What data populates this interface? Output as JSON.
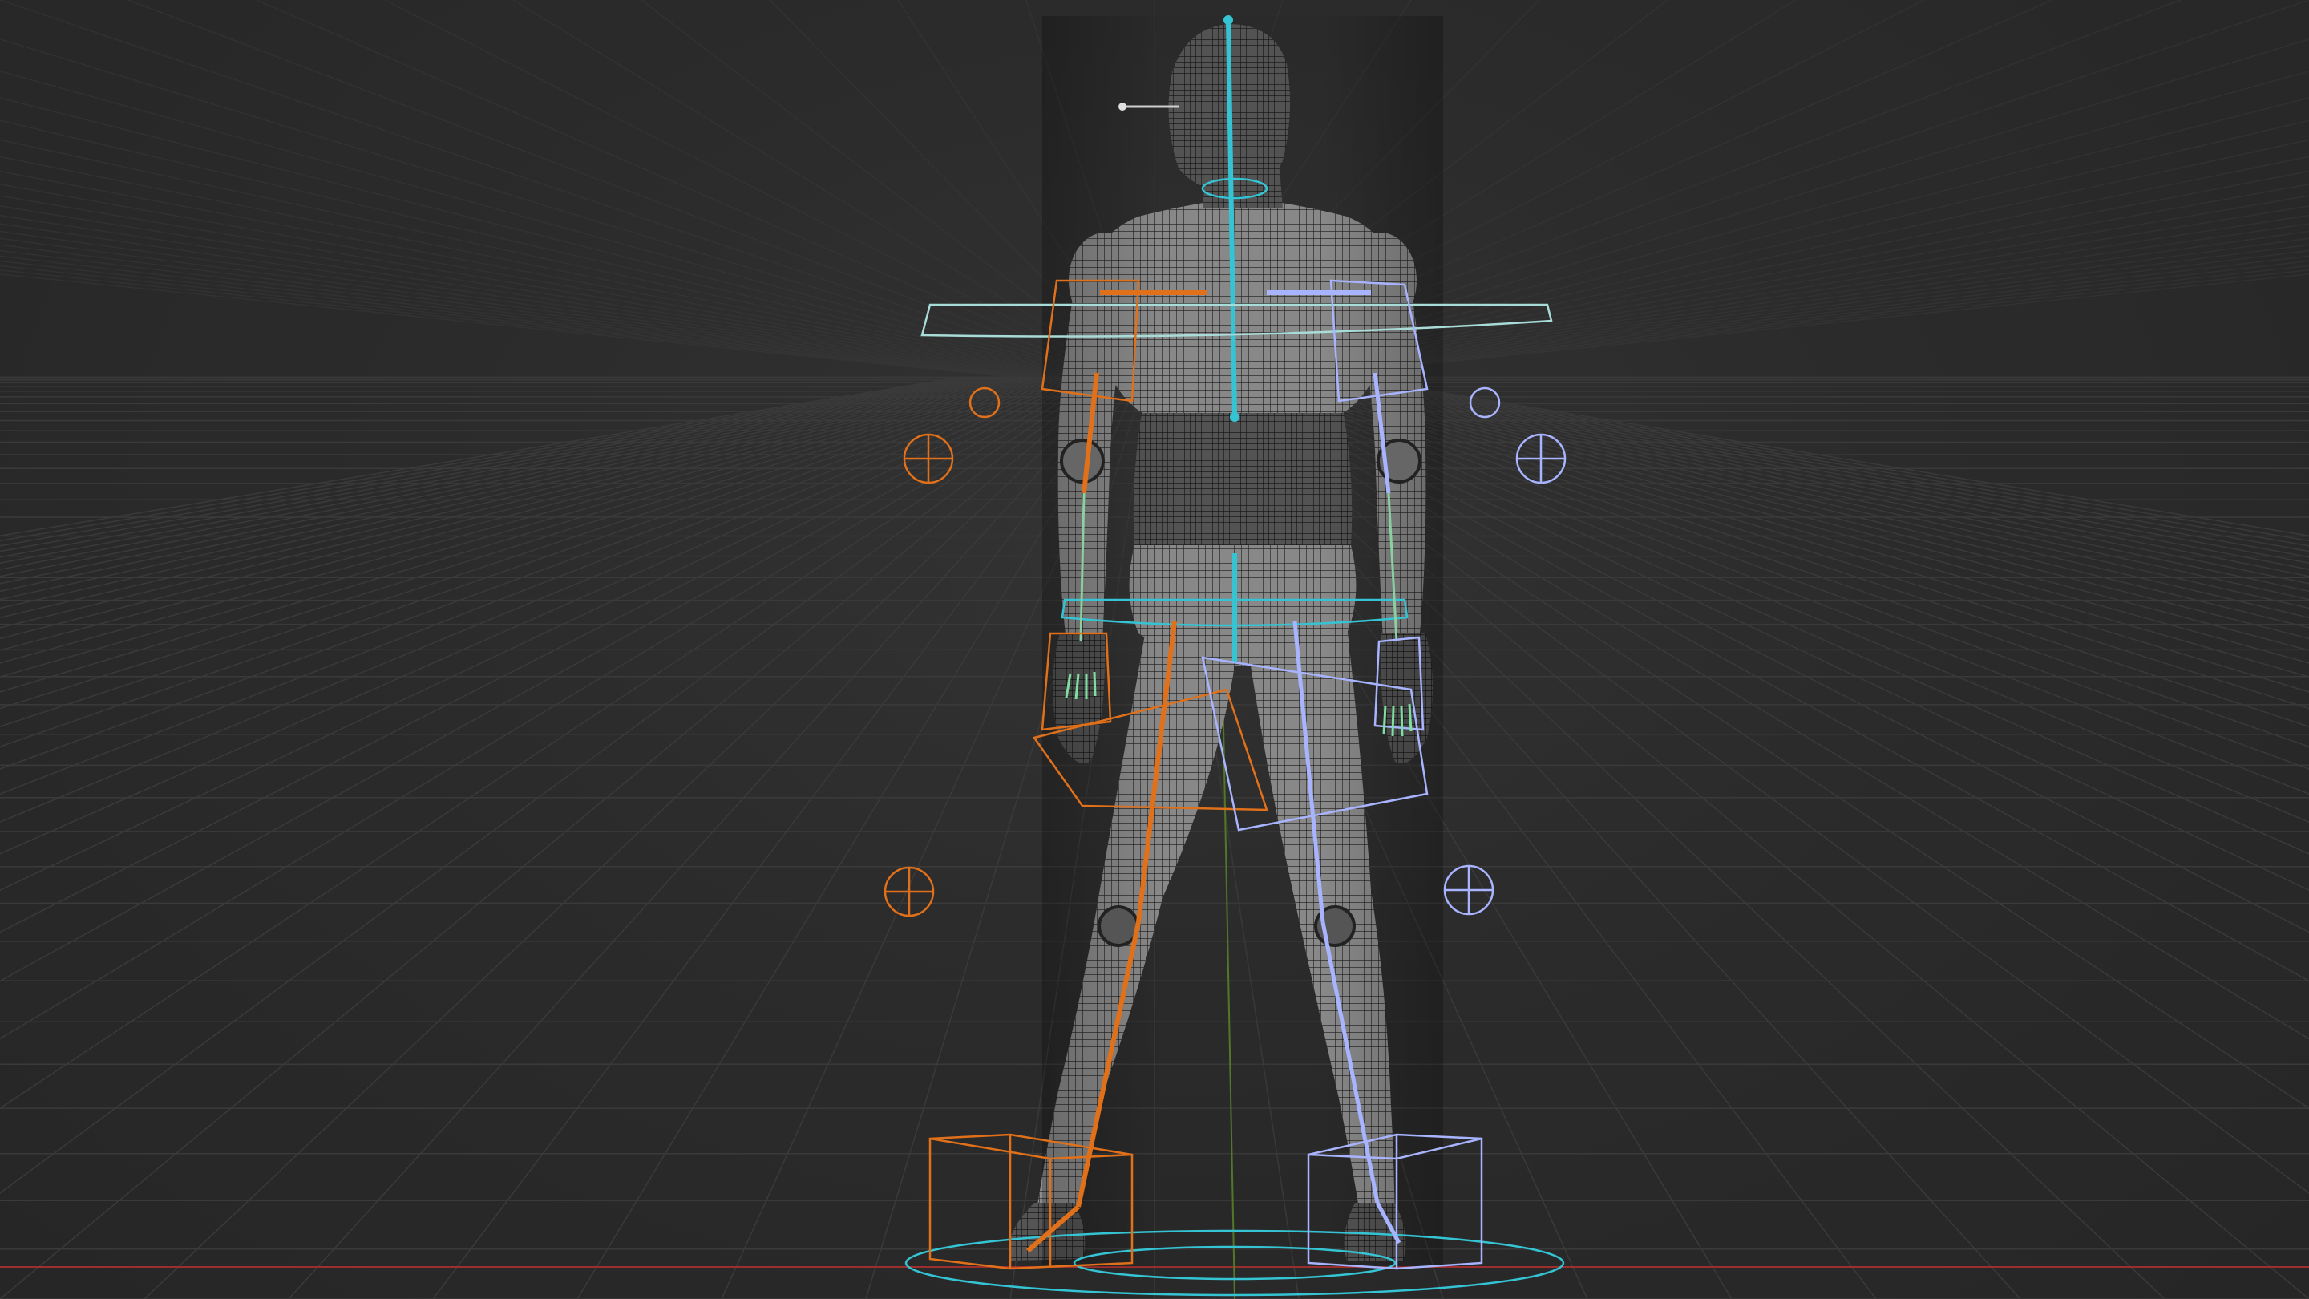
{
  "viewport": {
    "label": "3D viewport",
    "background": "#2b2b2b",
    "grid_color": "#3a3a3a",
    "x_axis_color": "#b03030",
    "y_axis_color": "#5a8a2a"
  },
  "scene": {
    "subject": "humanoid-character-wireframe",
    "view": "back",
    "mesh_color": "#8a8a8a",
    "mesh_wire_color": "#1a1a1a",
    "rig": {
      "center_color": "#34c4d4",
      "left_color": "#e0701a",
      "right_color": "#a8b4ff",
      "finger_color": "#7ee0a0"
    }
  }
}
